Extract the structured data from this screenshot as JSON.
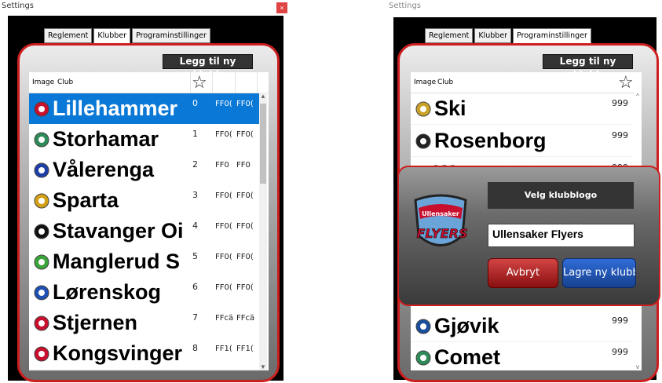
{
  "window_title": "Settings",
  "close_glyph": "×",
  "tabs": [
    "Reglement",
    "Klubber",
    "Programinstillinger"
  ],
  "add_club_label": "Legg til ny klubb",
  "columns": {
    "image": "Image",
    "club": "Club",
    "star": "☆"
  },
  "left_rows": [
    {
      "name": "Lillehammer",
      "num": "0",
      "c1": "FF0(",
      "c2": "FF0(",
      "logo": "lillehammer-logo",
      "color": "#c8102e"
    },
    {
      "name": "Storhamar",
      "num": "1",
      "c1": "FF0(",
      "c2": "FF0(",
      "logo": "storhamar-logo",
      "color": "#2e8b57"
    },
    {
      "name": "Vålerenga",
      "num": "2",
      "c1": "FF0",
      "c2": "FF0",
      "logo": "valerenga-logo",
      "color": "#1e3fa6"
    },
    {
      "name": "Sparta",
      "num": "3",
      "c1": "FF0(",
      "c2": "FF0(",
      "logo": "sparta-logo",
      "color": "#d4a017"
    },
    {
      "name": "Stavanger Oi",
      "num": "4",
      "c1": "FF0(",
      "c2": "FF0(",
      "logo": "stavanger-oilers-logo",
      "color": "#111111"
    },
    {
      "name": "Manglerud S",
      "num": "5",
      "c1": "FF0(",
      "c2": "FF0(",
      "logo": "manglerud-logo",
      "color": "#3aa33a"
    },
    {
      "name": "Lørenskog",
      "num": "6",
      "c1": "FF0(",
      "c2": "FF0(",
      "logo": "lorenskog-logo",
      "color": "#1f4fb0"
    },
    {
      "name": "Stjernen",
      "num": "7",
      "c1": "FFcä",
      "c2": "FFcä",
      "logo": "stjernen-logo",
      "color": "#c8102e"
    },
    {
      "name": "Kongsvinger",
      "num": "8",
      "c1": "FF1(",
      "c2": "FF1(",
      "logo": "kongsvinger-logo",
      "color": "#c8102e"
    }
  ],
  "right_rows": [
    {
      "name": "Ski",
      "num": "999",
      "logo": "ski-logo",
      "color": "#c9a227"
    },
    {
      "name": "Rosenborg",
      "num": "999",
      "logo": "rosenborg-logo",
      "color": "#222222"
    },
    {
      "name": "W",
      "num": "999",
      "logo": "w-logo",
      "color": "#1a4f9c"
    },
    {
      "name": "Gjøvik",
      "num": "999",
      "logo": "gjovik-logo",
      "color": "#1a4f9c"
    },
    {
      "name": "Comet",
      "num": "999",
      "logo": "comet-logo",
      "color": "#2e8b57"
    }
  ],
  "dialog": {
    "choose_logo_label": "Velg klubblogo",
    "club_name_value": "Ullensaker Flyers",
    "cancel_label": "Avbryt",
    "save_label": "Lagre ny klubb",
    "logo_text_top": "Ullensaker",
    "logo_text_main": "FLYERS"
  }
}
